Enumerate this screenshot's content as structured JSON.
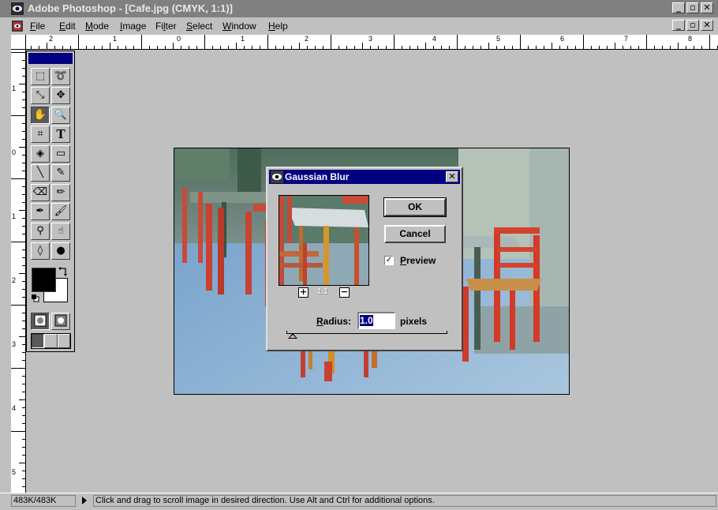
{
  "window": {
    "title": "Adobe Photoshop - [Cafe.jpg  (CMYK, 1:1)]",
    "buttons": [
      "_",
      "▫",
      "✕"
    ]
  },
  "menu": {
    "items": [
      {
        "label": "File",
        "u": "F",
        "rest": "ile"
      },
      {
        "label": "Edit",
        "u": "E",
        "rest": "dit"
      },
      {
        "label": "Mode",
        "u": "M",
        "rest": "ode"
      },
      {
        "label": "Image",
        "u": "I",
        "rest": "mage"
      },
      {
        "label": "Filter",
        "pre": "Fi",
        "u": "l",
        "rest": "ter"
      },
      {
        "label": "Select",
        "u": "S",
        "rest": "elect"
      },
      {
        "label": "Window",
        "u": "W",
        "rest": "indow"
      },
      {
        "label": "Help",
        "u": "H",
        "rest": "elp"
      }
    ]
  },
  "rulers": {
    "horizontal": [
      "2",
      "1",
      "0",
      "1",
      "2",
      "3",
      "4",
      "5",
      "6",
      "7",
      "8"
    ],
    "vertical": [
      "1",
      "0",
      "1",
      "2",
      "3",
      "4",
      "5"
    ]
  },
  "toolbox": {
    "tools": [
      {
        "name": "marquee-tool",
        "glyph": "⬚"
      },
      {
        "name": "lasso-tool",
        "glyph": "➰"
      },
      {
        "name": "magic-wand-tool",
        "glyph": "⤡"
      },
      {
        "name": "move-tool",
        "glyph": "✥"
      },
      {
        "name": "hand-tool",
        "glyph": "✋"
      },
      {
        "name": "zoom-tool",
        "glyph": "🔍"
      },
      {
        "name": "crop-tool",
        "glyph": "⌗"
      },
      {
        "name": "type-tool",
        "glyph": "T"
      },
      {
        "name": "paint-bucket-tool",
        "glyph": "◈"
      },
      {
        "name": "gradient-tool",
        "glyph": "▭"
      },
      {
        "name": "line-tool",
        "glyph": "╲"
      },
      {
        "name": "eyedropper-tool",
        "glyph": "✎"
      },
      {
        "name": "eraser-tool",
        "glyph": "⌫"
      },
      {
        "name": "pencil-tool",
        "glyph": "✏"
      },
      {
        "name": "airbrush-tool",
        "glyph": "✒"
      },
      {
        "name": "paintbrush-tool",
        "glyph": "🖌"
      },
      {
        "name": "rubber-stamp-tool",
        "glyph": "⚲"
      },
      {
        "name": "smudge-tool",
        "glyph": "☝"
      },
      {
        "name": "blur-tool",
        "glyph": "◊"
      },
      {
        "name": "dodge-tool",
        "glyph": "●"
      }
    ],
    "foreground_color": "#000000",
    "background_color": "#ffffff"
  },
  "dialog": {
    "title": "Gaussian Blur",
    "ok_label": "OK",
    "cancel_label": "Cancel",
    "preview_label": "Preview",
    "preview_u": "P",
    "preview_rest": "review",
    "preview_checked": "✓",
    "zoom_in": "+",
    "zoom_level": "1:1",
    "zoom_out": "−",
    "radius_label_u": "R",
    "radius_label_rest": "adius:",
    "radius_value": "1.0",
    "radius_unit": "pixels",
    "close": "✕"
  },
  "status": {
    "doc_size": "483K/483K",
    "message": "Click and drag to scroll image in desired direction.  Use Alt and Ctrl for additional options."
  },
  "colors": {
    "titlebar_inactive": "#808080",
    "dialog_title": "#000080",
    "chrome": "#c0c0c0"
  }
}
